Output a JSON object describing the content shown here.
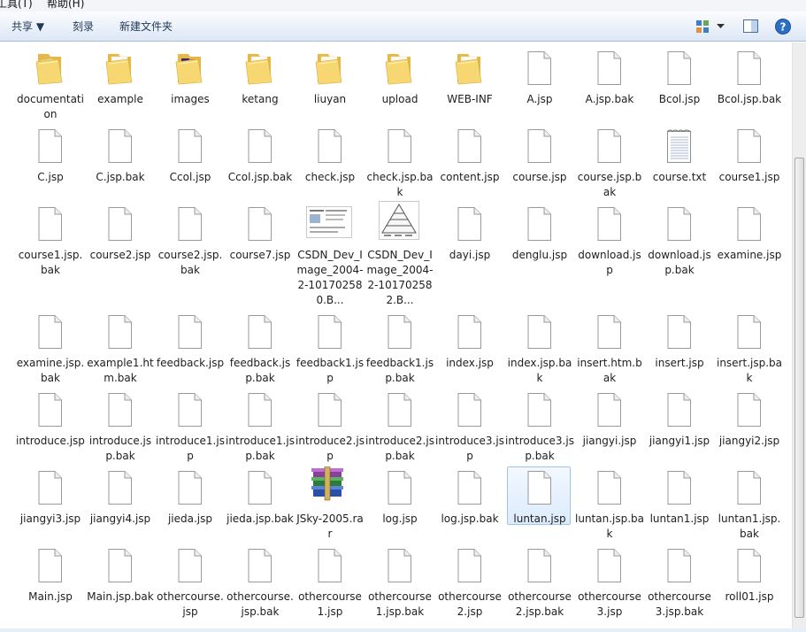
{
  "menu": {
    "tools": "工具(T)",
    "help": "帮助(H)"
  },
  "toolbar": {
    "share": "共享 ▼",
    "burn": "刻录",
    "new_folder": "新建文件夹"
  },
  "colors": {
    "toolbar_text": "#1e395b",
    "folder": "#f1c75a",
    "selection": "#dcebfc"
  },
  "items": [
    {
      "label": "documentation",
      "type": "folder-photo"
    },
    {
      "label": "example",
      "type": "folder"
    },
    {
      "label": "images",
      "type": "folder-images"
    },
    {
      "label": "ketang",
      "type": "folder"
    },
    {
      "label": "liuyan",
      "type": "folder"
    },
    {
      "label": "upload",
      "type": "folder"
    },
    {
      "label": "WEB-INF",
      "type": "folder"
    },
    {
      "label": "A.jsp",
      "type": "file"
    },
    {
      "label": "A.jsp.bak",
      "type": "file"
    },
    {
      "label": "Bcol.jsp",
      "type": "file"
    },
    {
      "label": "Bcol.jsp.bak",
      "type": "file"
    },
    {
      "label": "C.jsp",
      "type": "file"
    },
    {
      "label": "C.jsp.bak",
      "type": "file"
    },
    {
      "label": "Ccol.jsp",
      "type": "file"
    },
    {
      "label": "Ccol.jsp.bak",
      "type": "file"
    },
    {
      "label": "check.jsp",
      "type": "file"
    },
    {
      "label": "check.jsp.bak",
      "type": "file"
    },
    {
      "label": "content.jsp",
      "type": "file"
    },
    {
      "label": "course.jsp",
      "type": "file"
    },
    {
      "label": "course.jsp.bak",
      "type": "file"
    },
    {
      "label": "course.txt",
      "type": "txt"
    },
    {
      "label": "course1.jsp",
      "type": "file"
    },
    {
      "label": "course1.jsp.bak",
      "type": "file"
    },
    {
      "label": "course2.jsp",
      "type": "file"
    },
    {
      "label": "course2.jsp.bak",
      "type": "file"
    },
    {
      "label": "course7.jsp",
      "type": "file"
    },
    {
      "label": "CSDN_Dev_Image_2004-2-101702580.B...",
      "type": "image-doc"
    },
    {
      "label": "CSDN_Dev_Image_2004-2-101702582.B...",
      "type": "image-pyramid"
    },
    {
      "label": "dayi.jsp",
      "type": "file"
    },
    {
      "label": "denglu.jsp",
      "type": "file"
    },
    {
      "label": "download.jsp",
      "type": "file"
    },
    {
      "label": "download.jsp.bak",
      "type": "file"
    },
    {
      "label": "examine.jsp",
      "type": "file"
    },
    {
      "label": "examine.jsp.bak",
      "type": "file"
    },
    {
      "label": "example1.htm.bak",
      "type": "file"
    },
    {
      "label": "feedback.jsp",
      "type": "file"
    },
    {
      "label": "feedback.jsp.bak",
      "type": "file"
    },
    {
      "label": "feedback1.jsp",
      "type": "file"
    },
    {
      "label": "feedback1.jsp.bak",
      "type": "file"
    },
    {
      "label": "index.jsp",
      "type": "file"
    },
    {
      "label": "index.jsp.bak",
      "type": "file"
    },
    {
      "label": "insert.htm.bak",
      "type": "file"
    },
    {
      "label": "insert.jsp",
      "type": "file"
    },
    {
      "label": "insert.jsp.bak",
      "type": "file"
    },
    {
      "label": "introduce.jsp",
      "type": "file"
    },
    {
      "label": "introduce.jsp.bak",
      "type": "file"
    },
    {
      "label": "introduce1.jsp",
      "type": "file"
    },
    {
      "label": "introduce1.jsp.bak",
      "type": "file"
    },
    {
      "label": "introduce2.jsp",
      "type": "file"
    },
    {
      "label": "introduce2.jsp.bak",
      "type": "file"
    },
    {
      "label": "introduce3.jsp",
      "type": "file"
    },
    {
      "label": "introduce3.jsp.bak",
      "type": "file"
    },
    {
      "label": "jiangyi.jsp",
      "type": "file"
    },
    {
      "label": "jiangyi1.jsp",
      "type": "file"
    },
    {
      "label": "jiangyi2.jsp",
      "type": "file"
    },
    {
      "label": "jiangyi3.jsp",
      "type": "file"
    },
    {
      "label": "jiangyi4.jsp",
      "type": "file"
    },
    {
      "label": "jieda.jsp",
      "type": "file"
    },
    {
      "label": "jieda.jsp.bak",
      "type": "file"
    },
    {
      "label": "JSky-2005.rar",
      "type": "rar"
    },
    {
      "label": "log.jsp",
      "type": "file"
    },
    {
      "label": "log.jsp.bak",
      "type": "file"
    },
    {
      "label": "luntan.jsp",
      "type": "file",
      "selected": true
    },
    {
      "label": "luntan.jsp.bak",
      "type": "file"
    },
    {
      "label": "luntan1.jsp",
      "type": "file"
    },
    {
      "label": "luntan1.jsp.bak",
      "type": "file"
    },
    {
      "label": "Main.jsp",
      "type": "file"
    },
    {
      "label": "Main.jsp.bak",
      "type": "file"
    },
    {
      "label": "othercourse.jsp",
      "type": "file"
    },
    {
      "label": "othercourse.jsp.bak",
      "type": "file"
    },
    {
      "label": "othercourse1.jsp",
      "type": "file"
    },
    {
      "label": "othercourse1.jsp.bak",
      "type": "file"
    },
    {
      "label": "othercourse2.jsp",
      "type": "file"
    },
    {
      "label": "othercourse2.jsp.bak",
      "type": "file"
    },
    {
      "label": "othercourse3.jsp",
      "type": "file"
    },
    {
      "label": "othercourse3.jsp.bak",
      "type": "file"
    },
    {
      "label": "roll01.jsp",
      "type": "file"
    }
  ]
}
